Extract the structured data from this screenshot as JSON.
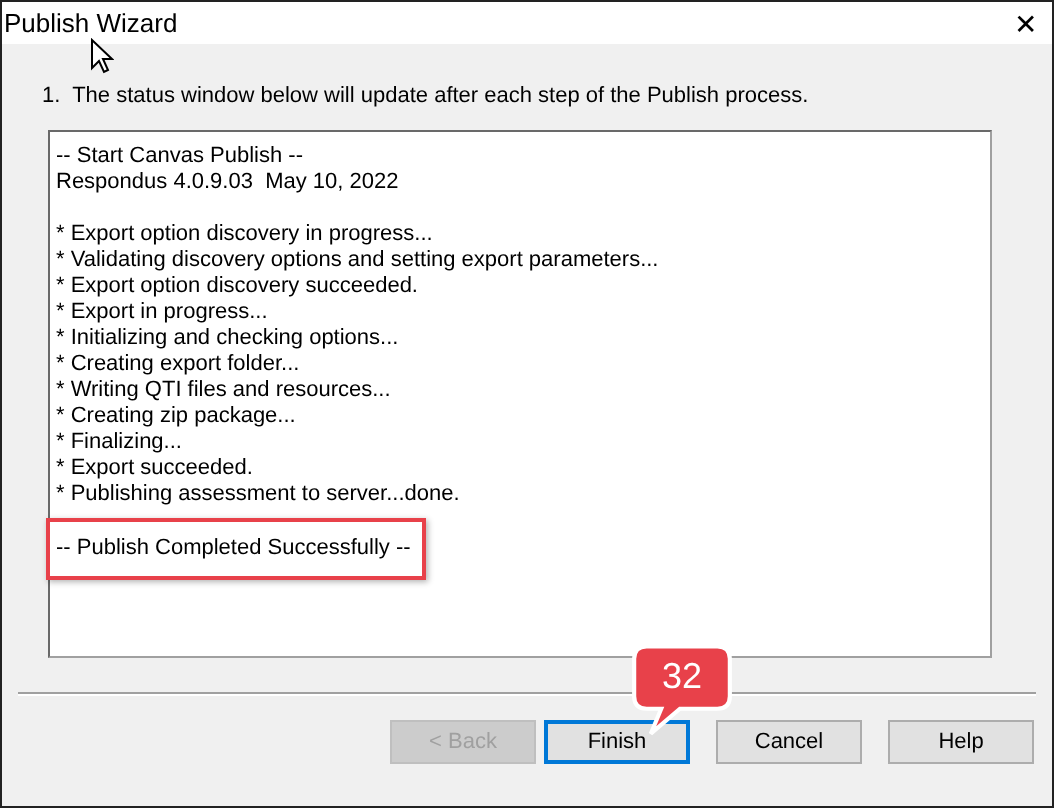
{
  "window": {
    "title": "Publish Wizard",
    "close": "✕"
  },
  "instruction": "1.  The status window below will update after each step of the Publish process.",
  "status_blocks": [
    {
      "highlighted": false,
      "lines": [
        "-- Start Canvas Publish --",
        "Respondus 4.0.9.03  May 10, 2022"
      ]
    },
    {
      "highlighted": false,
      "lines": [
        "* Export option discovery in progress...",
        "* Validating discovery options and setting export parameters...",
        "* Export option discovery succeeded.",
        "* Export in progress...",
        "* Initializing and checking options...",
        "* Creating export folder...",
        "* Writing QTI files and resources...",
        "* Creating zip package...",
        "* Finalizing...",
        "* Export succeeded.",
        "* Publishing assessment to server...done."
      ]
    },
    {
      "highlighted": true,
      "lines": [
        "-- Publish Completed Successfully --"
      ]
    }
  ],
  "callout": {
    "text": "32"
  },
  "buttons": [
    {
      "label": "< Back",
      "disabled": true,
      "selected": false
    },
    {
      "label": "Finish",
      "disabled": false,
      "selected": true
    },
    {
      "label": "Cancel",
      "disabled": false,
      "selected": false
    },
    {
      "label": "Help",
      "disabled": false,
      "selected": false
    }
  ]
}
